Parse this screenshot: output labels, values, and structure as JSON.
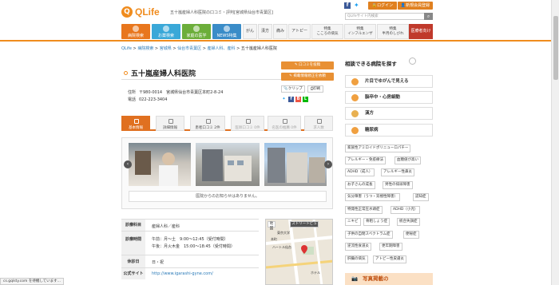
{
  "header": {
    "logo_text": "QLife",
    "site_desc": "五十嵐産婦人科医院の口コミ・評判[宮城県仙台市青葉区]",
    "login": "ログイン",
    "register": "新規会員登録",
    "search_placeholder": "QLifeサイト内検索"
  },
  "nav": {
    "main": [
      "病院検索",
      "お薬検索",
      "家庭の医学",
      "NEWS特集"
    ],
    "sub": [
      "がん",
      "漢方",
      "痛み",
      "アトピー"
    ],
    "sub_small": [
      [
        "特集",
        "こころの病気"
      ],
      [
        "特集",
        "インフルエンザ"
      ],
      [
        "特集",
        "半月のしびれ"
      ]
    ],
    "red": "医療者向け"
  },
  "breadcrumb": [
    "QLife",
    "病院検索",
    "宮城県",
    "仙台市青葉区",
    "産婦人科、産科",
    "五十嵐産婦人科医院"
  ],
  "hospital": {
    "name": "五十嵐産婦人科医院",
    "address_label": "住所",
    "address": "〒980-0014　宮城県仙台市青葉区本町2-8-24",
    "phone_label": "電話",
    "phone": "022-223-3404",
    "btn_review": "口コミを投稿",
    "btn_edit": "掲載情報修正を依頼",
    "btn_clip": "クリップ",
    "btn_print": "印刷"
  },
  "tabs": [
    "基本情報",
    "詳細情報",
    "患者口コミ 2件",
    "医師口コミ 0件",
    "名医の推薦 0件",
    "求人数"
  ],
  "gallery": {
    "notice": "医院からのお知らせはありません。",
    "prev": "‹",
    "next": "›"
  },
  "details": [
    {
      "key": "診療科目",
      "lines": [
        "産婦人科／産科"
      ]
    },
    {
      "key": "診療時間",
      "lines": [
        "午前：月〜土　9:00〜12:45（受付時間）",
        "午後：月火木金　15:00〜18:45（受付時間）"
      ]
    },
    {
      "key": "休診日",
      "lines": [
        "日・祝"
      ]
    },
    {
      "key": "公式サイト",
      "lines": [
        "http://www.igarashi-gyne.com/"
      ]
    }
  ],
  "map": {
    "map_btn": "地図",
    "street_btn": "ストリートビュー",
    "labels": [
      "本町",
      "東京大学",
      "ハートル仙台",
      "ホテル"
    ]
  },
  "sidebar": {
    "heading": "相談できる病院を探す",
    "buttons": [
      "片目でゆがんで見える",
      "脳卒中・心房細動",
      "漢方",
      "糖尿病"
    ],
    "tags": [
      [
        "家族性アミロイドポリニューロパチー"
      ],
      [
        "アレルギー・免疫療法",
        "血糖値が高い"
      ],
      [
        "ADHD（成人）",
        "アレルギー性鼻炎"
      ],
      [
        "お子さんの成長",
        "男性の排尿障害"
      ],
      [
        "気分障害（うつ・双極性障害）",
        "認知症"
      ],
      [
        "特発性正常圧水頭症",
        "ADHD（小児）"
      ],
      [
        "ニキビ",
        "骨粗しょう症",
        "統合失調症"
      ],
      [
        "子供の自閉スペクトラム症",
        "便秘症"
      ],
      [
        "逆流性食道炎",
        "更年期障害"
      ],
      [
        "肝臓の病気",
        "アトピー性皮膚炎"
      ]
    ],
    "banner": "写真掲載の"
  },
  "status_text": "cs.gqlsty.com を待機しています...",
  "colors": {
    "orange": "#f08c1e",
    "blue": "#2a7ab8"
  }
}
